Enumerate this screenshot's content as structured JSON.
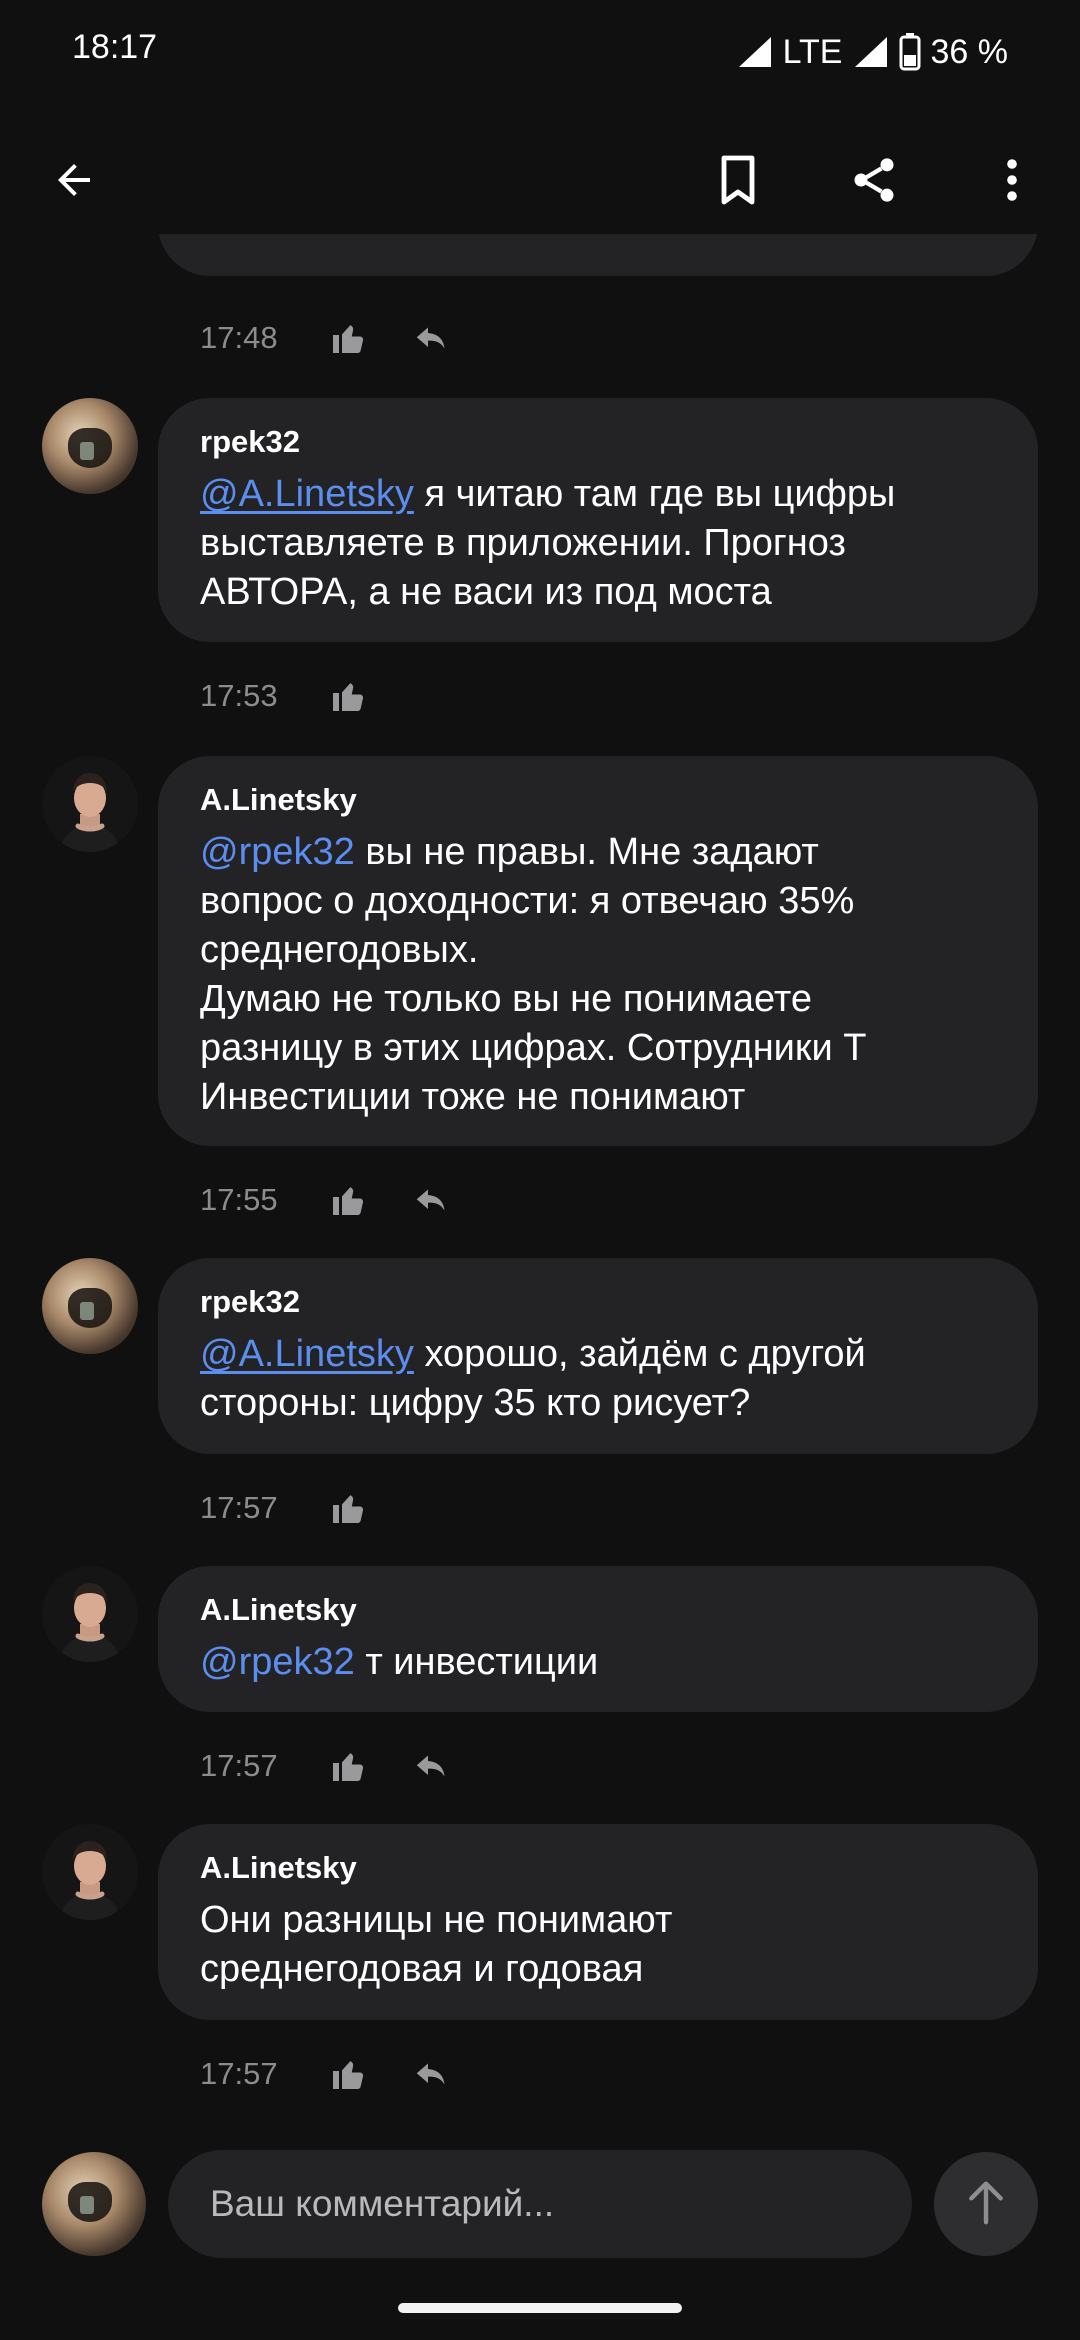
{
  "status_bar": {
    "time": "18:17",
    "network": "LTE",
    "battery": "36 %"
  },
  "toolbar": {
    "icons": [
      "arrow-left-icon",
      "bookmark-icon",
      "share-icon",
      "more-vertical-icon"
    ]
  },
  "comments": [
    {
      "partial": true,
      "time": "17:48",
      "has_reply": true
    },
    {
      "author": "rpek32",
      "mention": "@A.Linetsky",
      "text": " я читаю там где вы цифры\nвыставляете в приложении. Прогноз\nАВТОРА, а не васи из под моста",
      "time": "17:53",
      "has_reply": false
    },
    {
      "author": "A.Linetsky",
      "mention": "@rpek32",
      "text": " вы не правы. Мне задают\nвопрос о доходности: я отвечаю 35%\nсреднегодовых.\nДумаю не только вы не понимаете\nразницу в этих цифрах. Сотрудники Т\nИнвестиции тоже не понимают",
      "time": "17:55",
      "has_reply": true
    },
    {
      "author": "rpek32",
      "mention": "@A.Linetsky",
      "text": " хорошо, зайдём с другой\nстороны: цифру 35 кто рисует?",
      "time": "17:57",
      "has_reply": false
    },
    {
      "author": "A.Linetsky",
      "mention": "@rpek32",
      "text": " т инвестиции",
      "time": "17:57",
      "has_reply": true
    },
    {
      "author": "A.Linetsky",
      "mention": "",
      "text": "Они разницы не понимают\nсреднегодовая и годовая",
      "time": "17:57",
      "has_reply": true
    }
  ],
  "composer": {
    "placeholder": "Ваш комментарий..."
  },
  "colors": {
    "background": "#101010",
    "bubble": "#232325",
    "mention": "#5b8ef0",
    "muted": "#8c8c8e"
  }
}
